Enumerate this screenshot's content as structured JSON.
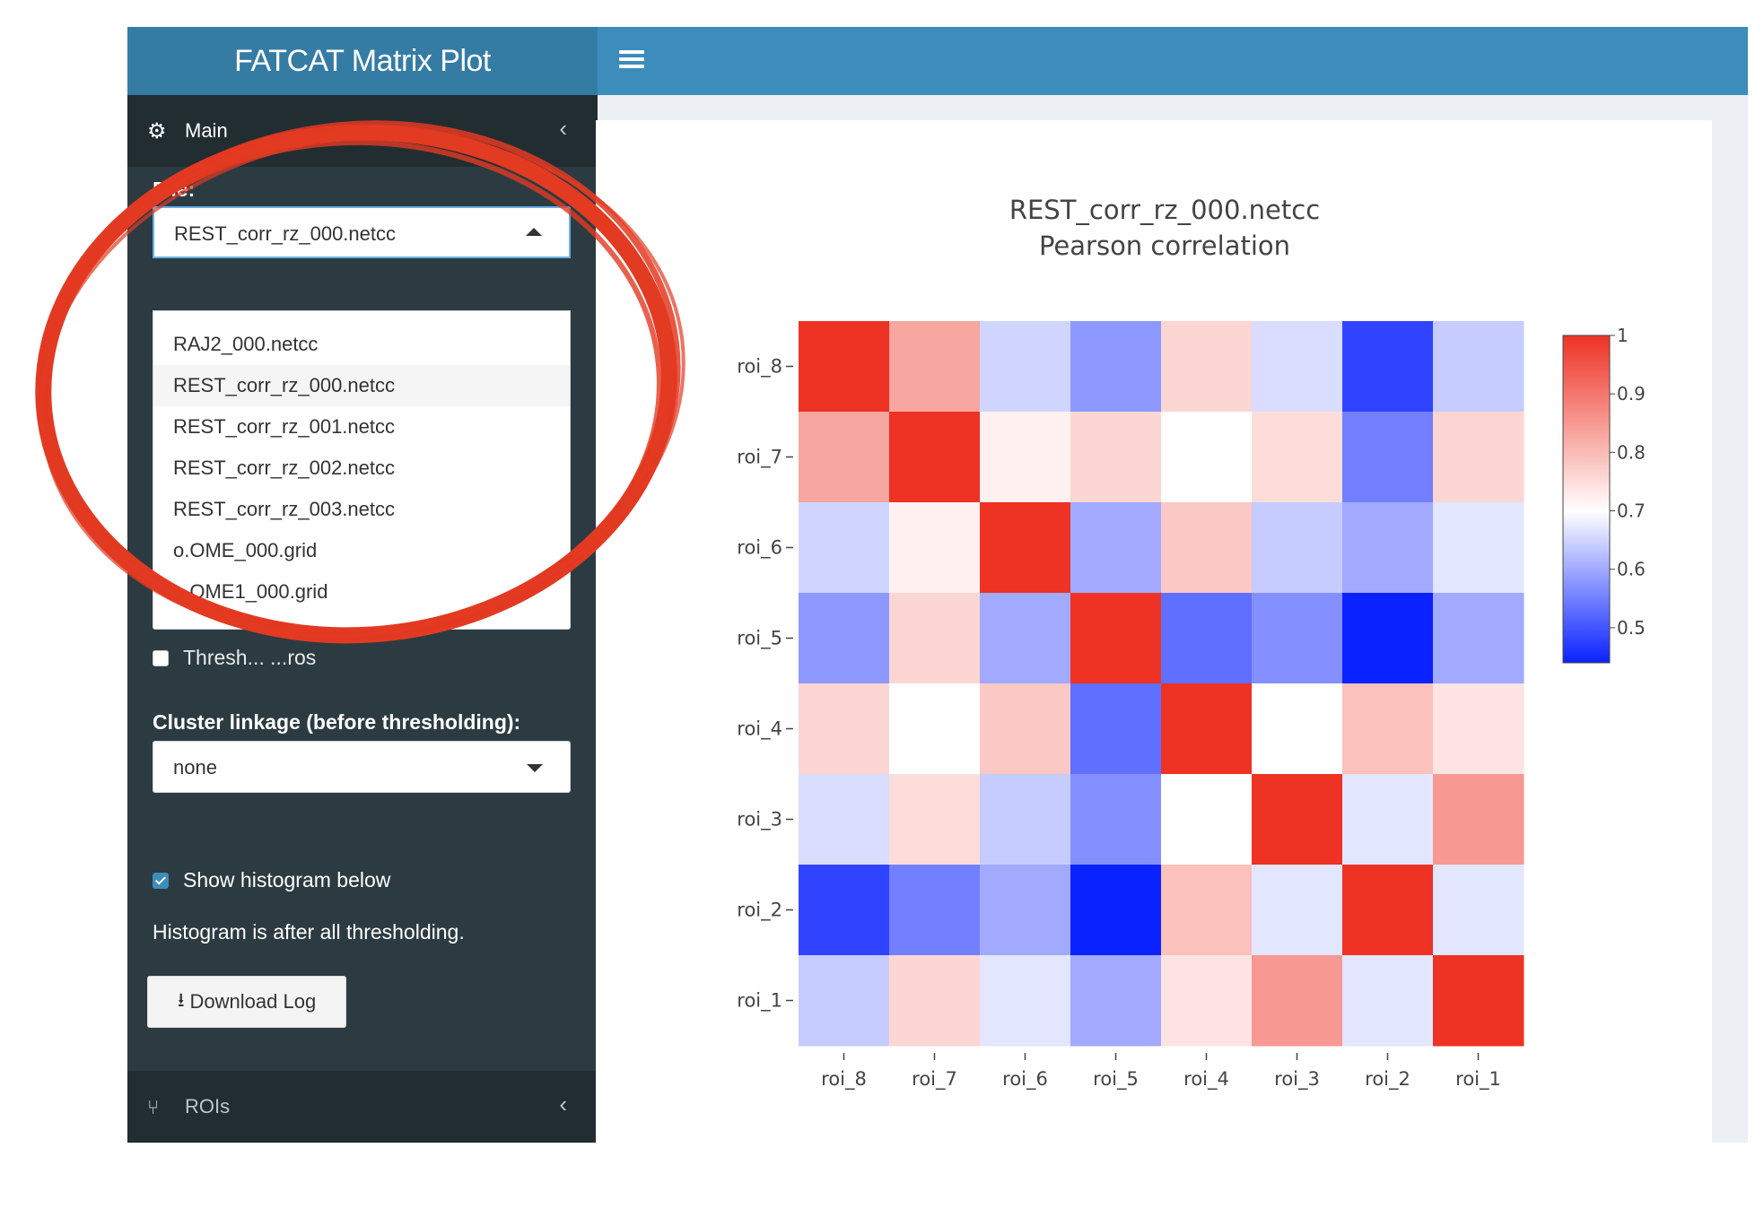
{
  "header": {
    "title": "FATCAT Matrix Plot"
  },
  "sidebar": {
    "main_section": {
      "label": "Main"
    },
    "file": {
      "label": "File:",
      "value": "REST_corr_rz_000.netcc",
      "options": [
        "RAJ2_000.netcc",
        "REST_corr_rz_000.netcc",
        "REST_corr_rz_001.netcc",
        "REST_corr_rz_002.netcc",
        "REST_corr_rz_003.netcc",
        "o.OME_000.grid",
        "o.OME1_000.grid"
      ],
      "selected_index": 1
    },
    "threshold_checkbox": {
      "label": "Thresh... ...ros",
      "checked": false
    },
    "cluster": {
      "label": "Cluster linkage (before thresholding):",
      "value": "none"
    },
    "histogram_checkbox": {
      "label": "Show histogram below",
      "checked": true
    },
    "histogram_note": "Histogram is after all thresholding.",
    "download_button": {
      "label": "Download Log",
      "icon": "download-icon"
    },
    "rois_section": {
      "label": "ROIs"
    }
  },
  "colors": {
    "accent": "#3c8dbc",
    "sidebar": "#2c3b41",
    "circle": "#e33a22"
  },
  "chart_data": {
    "type": "heatmap",
    "title": "REST_corr_rz_000.netcc",
    "subtitle": "Pearson correlation",
    "x_labels": [
      "roi_8",
      "roi_7",
      "roi_6",
      "roi_5",
      "roi_4",
      "roi_3",
      "roi_2",
      "roi_1"
    ],
    "y_labels": [
      "roi_8",
      "roi_7",
      "roi_6",
      "roi_5",
      "roi_4",
      "roi_3",
      "roi_2",
      "roi_1"
    ],
    "values": [
      [
        1.0,
        0.83,
        0.65,
        0.58,
        0.76,
        0.66,
        0.48,
        0.64
      ],
      [
        0.83,
        1.0,
        0.72,
        0.76,
        0.7,
        0.75,
        0.55,
        0.76
      ],
      [
        0.65,
        0.72,
        1.0,
        0.6,
        0.78,
        0.64,
        0.6,
        0.67
      ],
      [
        0.58,
        0.76,
        0.6,
        1.0,
        0.53,
        0.57,
        0.44,
        0.6
      ],
      [
        0.76,
        0.7,
        0.78,
        0.53,
        1.0,
        0.7,
        0.79,
        0.74
      ],
      [
        0.66,
        0.75,
        0.64,
        0.57,
        0.7,
        1.0,
        0.67,
        0.85
      ],
      [
        0.48,
        0.55,
        0.6,
        0.44,
        0.79,
        0.67,
        1.0,
        0.67
      ],
      [
        0.64,
        0.76,
        0.67,
        0.6,
        0.74,
        0.85,
        0.67,
        1.0
      ]
    ],
    "colorbar": {
      "min": 0.44,
      "max": 1.0,
      "ticks": [
        "1",
        "0.9",
        "0.8",
        "0.7",
        "0.6",
        "0.5"
      ],
      "tick_values": [
        1,
        0.9,
        0.8,
        0.7,
        0.6,
        0.5
      ]
    },
    "colorscale": [
      "#0a22ff",
      "#ffffff",
      "#ee3224"
    ]
  }
}
